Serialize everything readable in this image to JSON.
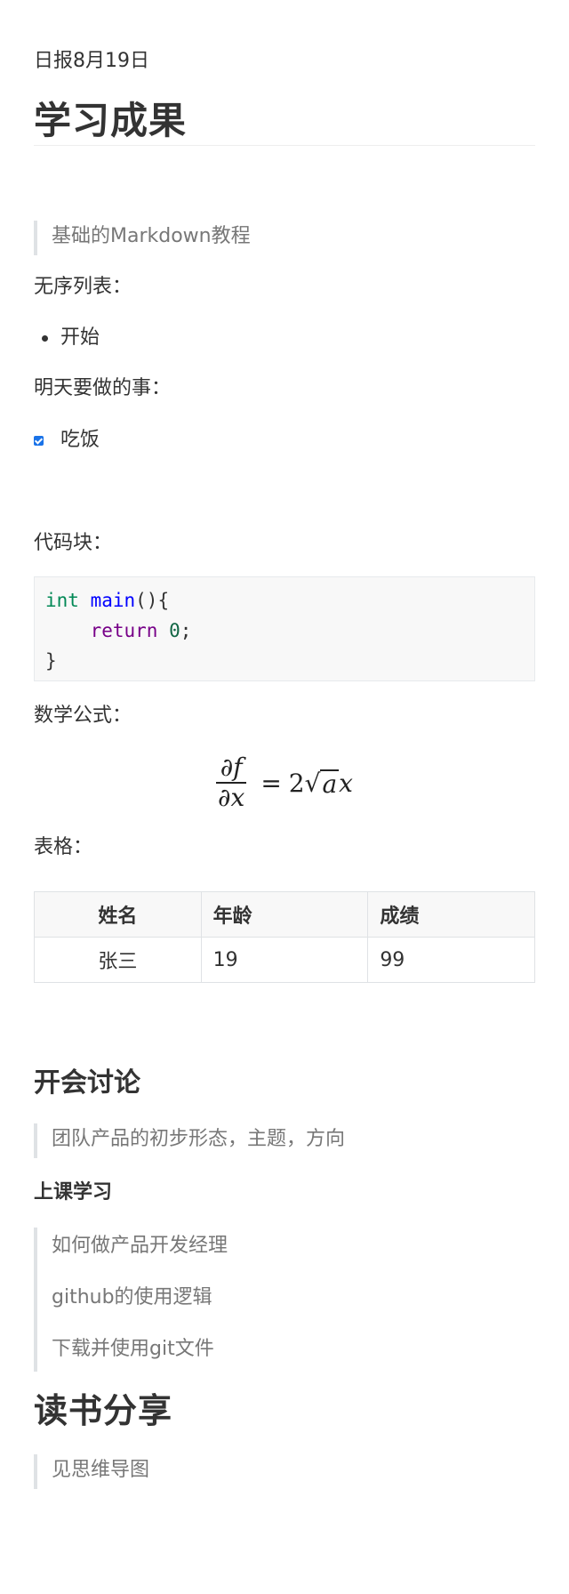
{
  "header": {
    "date": "日报8月19日",
    "title": "学习成果"
  },
  "intro_quote": "基础的Markdown教程",
  "unordered": {
    "label": "无序列表：",
    "items": [
      "开始"
    ]
  },
  "todo": {
    "label": "明天要做的事：",
    "items": [
      {
        "text": "吃饭",
        "checked": true
      }
    ]
  },
  "code": {
    "label": "代码块：",
    "lines": [
      {
        "type": "int",
        "fn": " main",
        "rest": "(){"
      },
      {
        "indent": "    ",
        "kw": "return",
        "num": "0",
        "end": ";"
      },
      {
        "text": "}"
      }
    ]
  },
  "formula": {
    "label": "数学公式：",
    "numerator": "∂f",
    "denominator": "∂x",
    "equals": "=",
    "coef": "2",
    "radicand": "a",
    "var": "x"
  },
  "table": {
    "label": "表格：",
    "headers": [
      "姓名",
      "年龄",
      "成绩"
    ],
    "rows": [
      [
        "张三",
        "19",
        "99"
      ]
    ]
  },
  "meeting": {
    "heading": "开会讨论",
    "quote": "团队产品的初步形态，主题，方向"
  },
  "class": {
    "heading": "上课学习",
    "quotes": [
      "如何做产品开发经理",
      "github的使用逻辑",
      "下载并使用git文件"
    ]
  },
  "reading": {
    "heading": "读书分享",
    "quote": "见思维导图"
  }
}
